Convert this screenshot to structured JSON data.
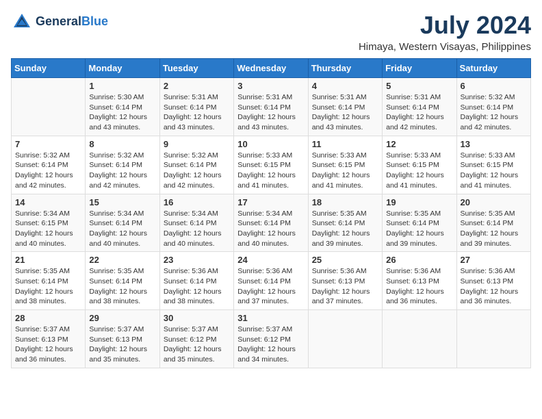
{
  "logo": {
    "line1": "General",
    "line2": "Blue"
  },
  "title": "July 2024",
  "location": "Himaya, Western Visayas, Philippines",
  "days_header": [
    "Sunday",
    "Monday",
    "Tuesday",
    "Wednesday",
    "Thursday",
    "Friday",
    "Saturday"
  ],
  "weeks": [
    [
      {
        "num": "",
        "info": ""
      },
      {
        "num": "1",
        "info": "Sunrise: 5:30 AM\nSunset: 6:14 PM\nDaylight: 12 hours\nand 43 minutes."
      },
      {
        "num": "2",
        "info": "Sunrise: 5:31 AM\nSunset: 6:14 PM\nDaylight: 12 hours\nand 43 minutes."
      },
      {
        "num": "3",
        "info": "Sunrise: 5:31 AM\nSunset: 6:14 PM\nDaylight: 12 hours\nand 43 minutes."
      },
      {
        "num": "4",
        "info": "Sunrise: 5:31 AM\nSunset: 6:14 PM\nDaylight: 12 hours\nand 43 minutes."
      },
      {
        "num": "5",
        "info": "Sunrise: 5:31 AM\nSunset: 6:14 PM\nDaylight: 12 hours\nand 42 minutes."
      },
      {
        "num": "6",
        "info": "Sunrise: 5:32 AM\nSunset: 6:14 PM\nDaylight: 12 hours\nand 42 minutes."
      }
    ],
    [
      {
        "num": "7",
        "info": "Sunrise: 5:32 AM\nSunset: 6:14 PM\nDaylight: 12 hours\nand 42 minutes."
      },
      {
        "num": "8",
        "info": "Sunrise: 5:32 AM\nSunset: 6:14 PM\nDaylight: 12 hours\nand 42 minutes."
      },
      {
        "num": "9",
        "info": "Sunrise: 5:32 AM\nSunset: 6:14 PM\nDaylight: 12 hours\nand 42 minutes."
      },
      {
        "num": "10",
        "info": "Sunrise: 5:33 AM\nSunset: 6:15 PM\nDaylight: 12 hours\nand 41 minutes."
      },
      {
        "num": "11",
        "info": "Sunrise: 5:33 AM\nSunset: 6:15 PM\nDaylight: 12 hours\nand 41 minutes."
      },
      {
        "num": "12",
        "info": "Sunrise: 5:33 AM\nSunset: 6:15 PM\nDaylight: 12 hours\nand 41 minutes."
      },
      {
        "num": "13",
        "info": "Sunrise: 5:33 AM\nSunset: 6:15 PM\nDaylight: 12 hours\nand 41 minutes."
      }
    ],
    [
      {
        "num": "14",
        "info": "Sunrise: 5:34 AM\nSunset: 6:15 PM\nDaylight: 12 hours\nand 40 minutes."
      },
      {
        "num": "15",
        "info": "Sunrise: 5:34 AM\nSunset: 6:14 PM\nDaylight: 12 hours\nand 40 minutes."
      },
      {
        "num": "16",
        "info": "Sunrise: 5:34 AM\nSunset: 6:14 PM\nDaylight: 12 hours\nand 40 minutes."
      },
      {
        "num": "17",
        "info": "Sunrise: 5:34 AM\nSunset: 6:14 PM\nDaylight: 12 hours\nand 40 minutes."
      },
      {
        "num": "18",
        "info": "Sunrise: 5:35 AM\nSunset: 6:14 PM\nDaylight: 12 hours\nand 39 minutes."
      },
      {
        "num": "19",
        "info": "Sunrise: 5:35 AM\nSunset: 6:14 PM\nDaylight: 12 hours\nand 39 minutes."
      },
      {
        "num": "20",
        "info": "Sunrise: 5:35 AM\nSunset: 6:14 PM\nDaylight: 12 hours\nand 39 minutes."
      }
    ],
    [
      {
        "num": "21",
        "info": "Sunrise: 5:35 AM\nSunset: 6:14 PM\nDaylight: 12 hours\nand 38 minutes."
      },
      {
        "num": "22",
        "info": "Sunrise: 5:35 AM\nSunset: 6:14 PM\nDaylight: 12 hours\nand 38 minutes."
      },
      {
        "num": "23",
        "info": "Sunrise: 5:36 AM\nSunset: 6:14 PM\nDaylight: 12 hours\nand 38 minutes."
      },
      {
        "num": "24",
        "info": "Sunrise: 5:36 AM\nSunset: 6:14 PM\nDaylight: 12 hours\nand 37 minutes."
      },
      {
        "num": "25",
        "info": "Sunrise: 5:36 AM\nSunset: 6:13 PM\nDaylight: 12 hours\nand 37 minutes."
      },
      {
        "num": "26",
        "info": "Sunrise: 5:36 AM\nSunset: 6:13 PM\nDaylight: 12 hours\nand 36 minutes."
      },
      {
        "num": "27",
        "info": "Sunrise: 5:36 AM\nSunset: 6:13 PM\nDaylight: 12 hours\nand 36 minutes."
      }
    ],
    [
      {
        "num": "28",
        "info": "Sunrise: 5:37 AM\nSunset: 6:13 PM\nDaylight: 12 hours\nand 36 minutes."
      },
      {
        "num": "29",
        "info": "Sunrise: 5:37 AM\nSunset: 6:13 PM\nDaylight: 12 hours\nand 35 minutes."
      },
      {
        "num": "30",
        "info": "Sunrise: 5:37 AM\nSunset: 6:12 PM\nDaylight: 12 hours\nand 35 minutes."
      },
      {
        "num": "31",
        "info": "Sunrise: 5:37 AM\nSunset: 6:12 PM\nDaylight: 12 hours\nand 34 minutes."
      },
      {
        "num": "",
        "info": ""
      },
      {
        "num": "",
        "info": ""
      },
      {
        "num": "",
        "info": ""
      }
    ]
  ]
}
